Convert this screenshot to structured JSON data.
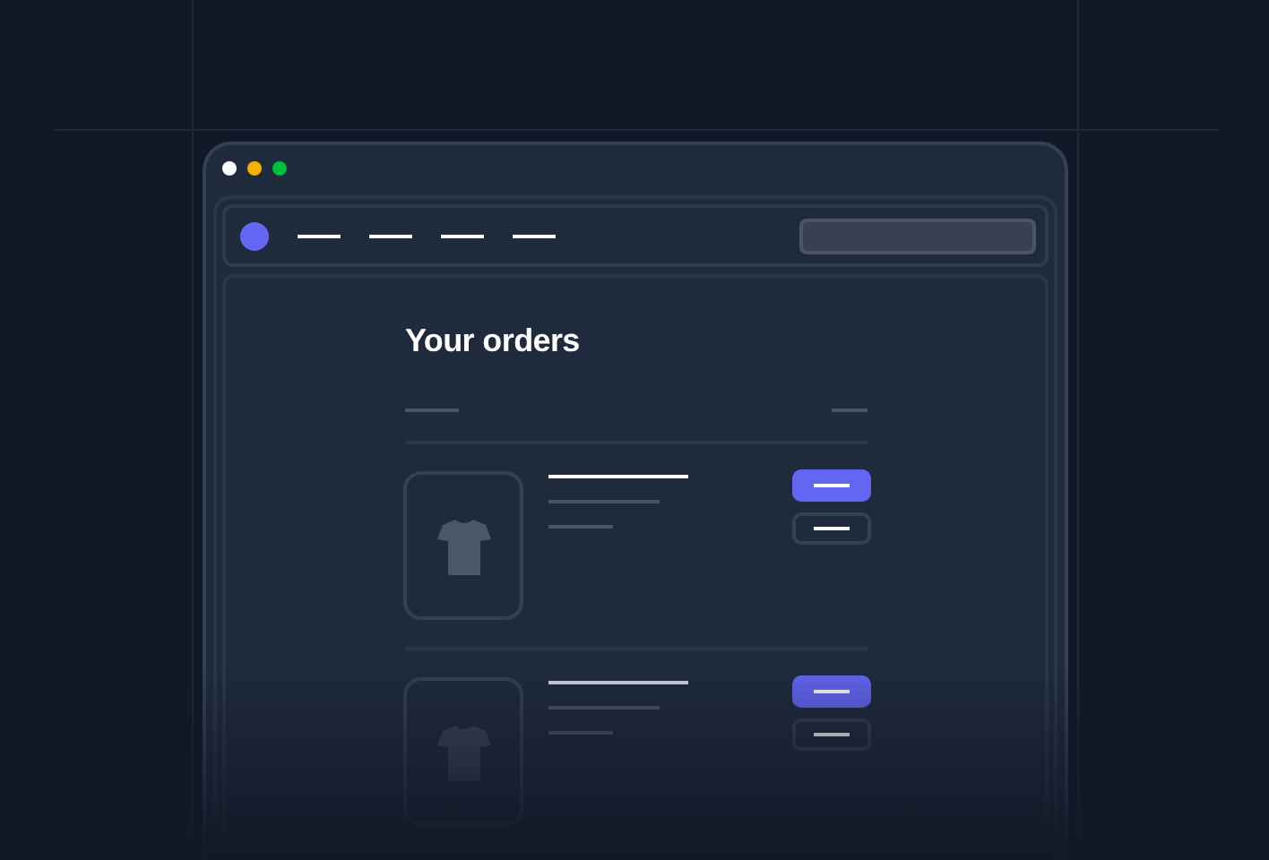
{
  "heading": "Your orders"
}
